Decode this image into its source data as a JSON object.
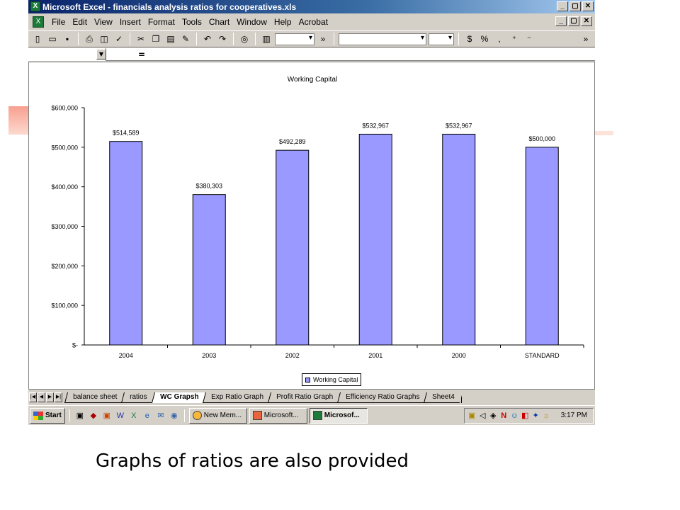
{
  "window": {
    "title": "Microsoft Excel - financials analysis ratios for cooperatives.xls",
    "controls": [
      "_",
      "▢",
      "✕"
    ]
  },
  "menu": [
    "File",
    "Edit",
    "View",
    "Insert",
    "Format",
    "Tools",
    "Chart",
    "Window",
    "Help",
    "Acrobat"
  ],
  "formula_bar": {
    "equals": "="
  },
  "chart_data": {
    "type": "bar",
    "title": "Working Capital",
    "categories": [
      "2004",
      "2003",
      "2002",
      "2001",
      "2000",
      "STANDARD"
    ],
    "series": [
      {
        "name": "Working Capital",
        "values": [
          514589,
          380303,
          492289,
          532967,
          532967,
          500000
        ]
      }
    ],
    "data_labels": [
      "$514,589",
      "$380,303",
      "$492,289",
      "$532,967",
      "$532,967",
      "$500,000"
    ],
    "y_ticks": [
      "$-",
      "$100,000",
      "$200,000",
      "$300,000",
      "$400,000",
      "$500,000",
      "$600,000"
    ],
    "ylim": [
      0,
      600000
    ],
    "bar_color": "#9999ff",
    "legend": "bottom",
    "grid": false
  },
  "sheet_tabs": [
    "balance sheet",
    "ratios",
    "WC Grapsh",
    "Exp Ratio Graph",
    "Profit Ratio Graph",
    "Efficiency Ratio Graphs",
    "Sheet4"
  ],
  "active_tab": "WC Grapsh",
  "taskbar": {
    "start_label": "Start",
    "tasks": [
      "New Mem...",
      "Microsoft...",
      "Microsof..."
    ],
    "clock": "3:17 PM"
  },
  "caption": "Graphs of ratios are also provided"
}
